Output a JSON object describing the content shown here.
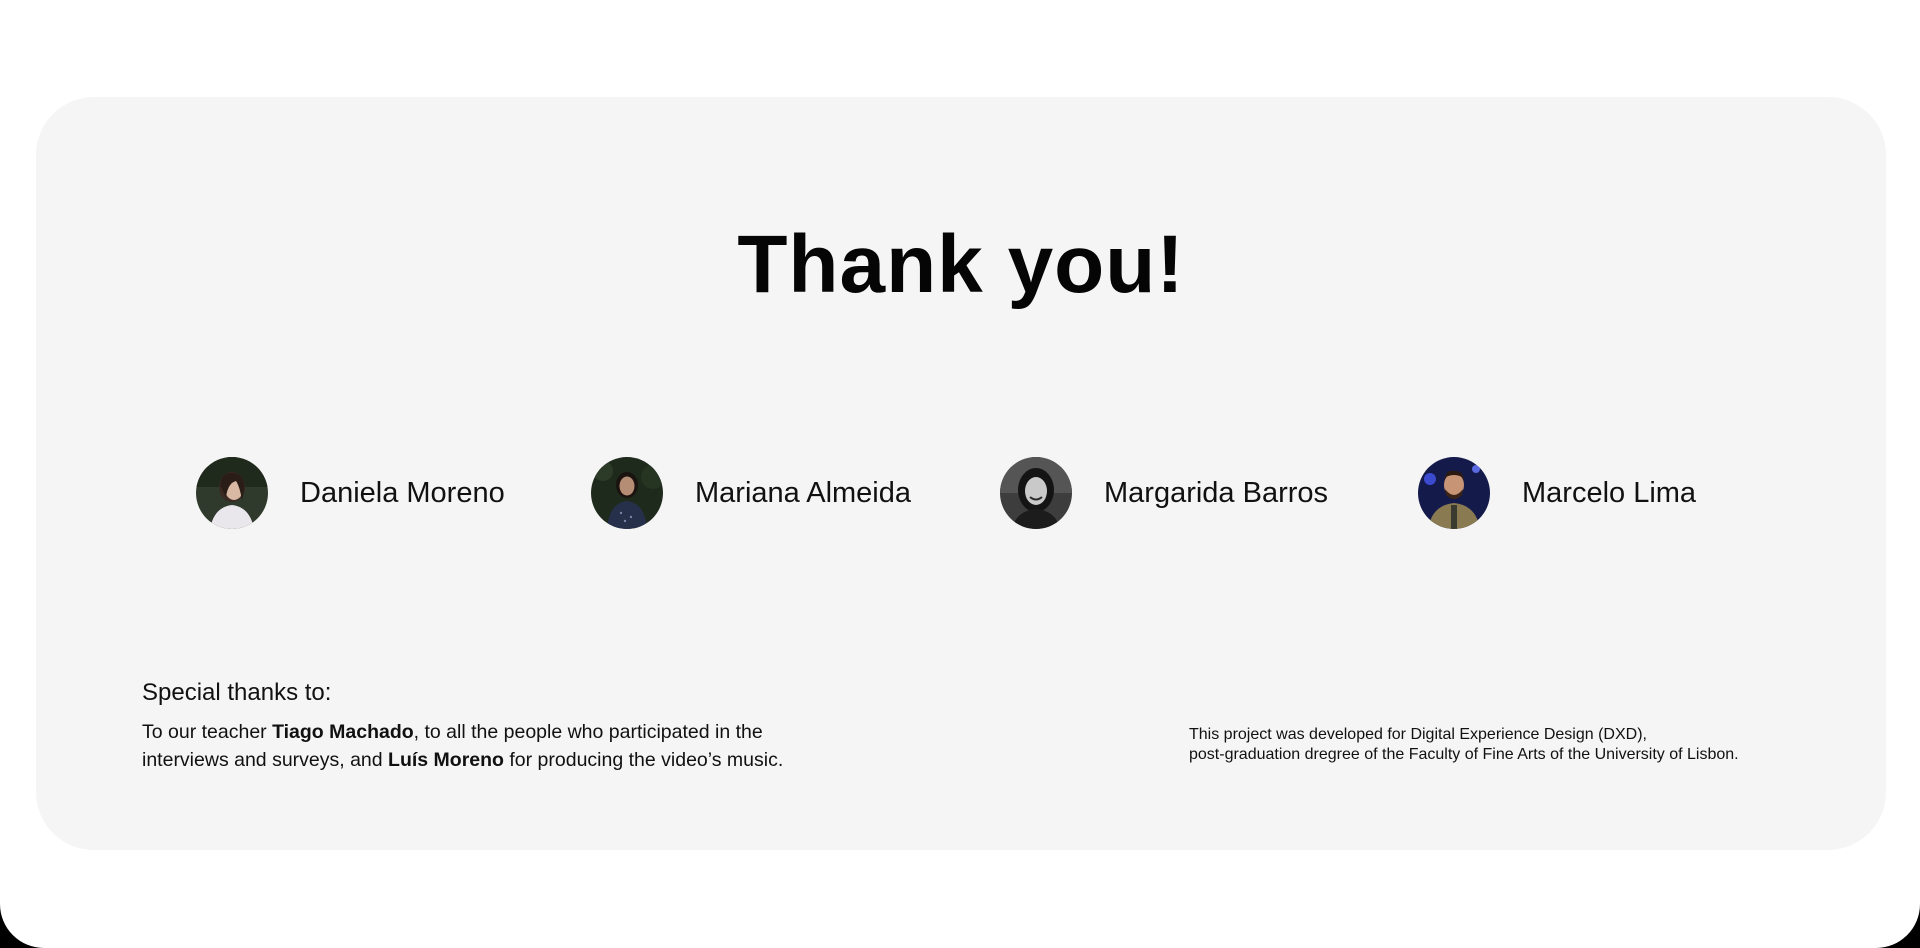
{
  "colors": {
    "page_background": "#ffffff",
    "card_background": "#f5f5f5",
    "text": "#111111"
  },
  "title": "Thank you!",
  "team": [
    {
      "name": "Daniela Moreno",
      "avatar": "avatar-photo-daniela"
    },
    {
      "name": "Mariana Almeida",
      "avatar": "avatar-photo-mariana"
    },
    {
      "name": "Margarida Barros",
      "avatar": "avatar-photo-margarida"
    },
    {
      "name": "Marcelo Lima",
      "avatar": "avatar-photo-marcelo"
    }
  ],
  "special_thanks": {
    "heading": "Special thanks to:",
    "line1_prefix": "To our teacher ",
    "teacher": "Tiago Machado",
    "line1_suffix": ", to all the people who participated in the",
    "line2_prefix": "interviews and surveys, and ",
    "musician": "Luís Moreno",
    "line2_suffix": " for producing the video’s music."
  },
  "footnote": {
    "line1": "This project was developed for Digital Experience Design (DXD),",
    "line2": "post-graduation dregree of the Faculty of Fine Arts of the University of Lisbon."
  }
}
